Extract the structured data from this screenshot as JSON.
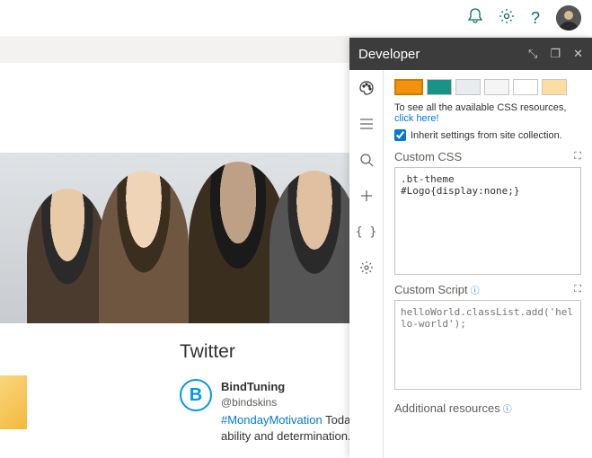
{
  "topbar": {
    "icons": [
      "bell",
      "gear",
      "help"
    ]
  },
  "content": {
    "section_title": "Twitter",
    "tweet": {
      "avatar_letter": "B",
      "name": "BindTuning",
      "handle": "@bindskins",
      "hashtag": "#MondayMotivation",
      "text_after": " Today is t",
      "line2": "ability and determination. 🎯"
    }
  },
  "dev": {
    "title": "Developer",
    "swatches": [
      "#f2930d",
      "#179387",
      "#e8ecef",
      "#f5f5f5",
      "#ffffff",
      "#fcdda2"
    ],
    "resources_prefix": "To see all the available CSS resources, ",
    "resources_link": "click here!",
    "inherit_label": "Inherit settings from site collection.",
    "css_label": "Custom CSS",
    "css_value": ".bt-theme #Logo{display:none;}",
    "script_label": "Custom Script",
    "script_placeholder": "helloWorld.classList.add('hello-world');",
    "additional_label": "Additional resources"
  }
}
